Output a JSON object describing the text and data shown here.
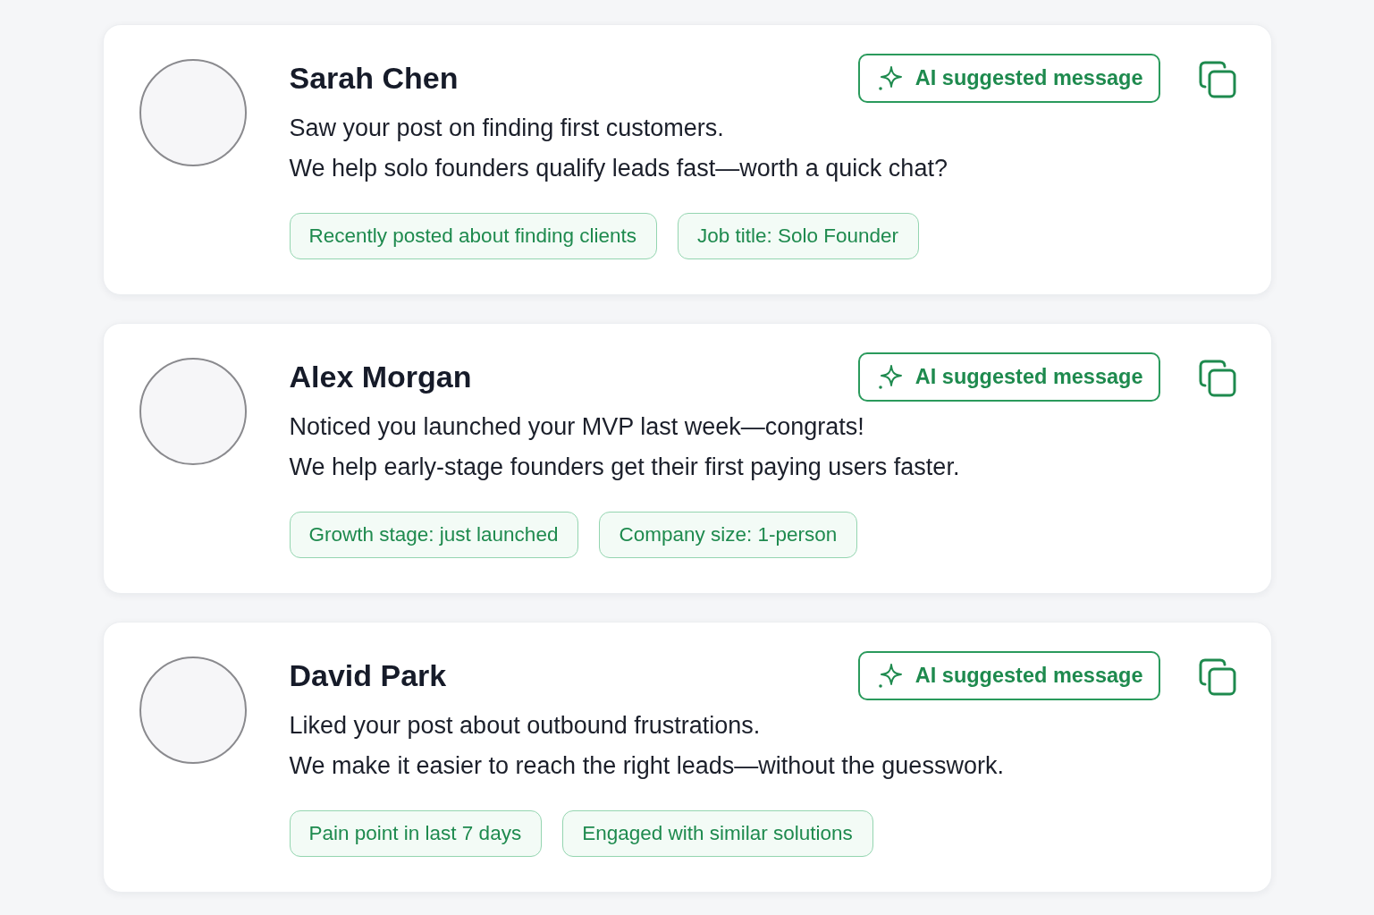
{
  "leads": [
    {
      "name": "Sarah Chen",
      "ai_button": "AI suggested message",
      "message": "Saw your post on finding first customers.\nWe help solo founders qualify leads fast—worth a quick chat?",
      "tags": [
        "Recently posted about finding clients",
        "Job title: Solo Founder"
      ]
    },
    {
      "name": "Alex Morgan",
      "ai_button": "AI suggested message",
      "message": "Noticed you launched your MVP last week—congrats!\nWe help early-stage founders get their first paying users faster.",
      "tags": [
        "Growth stage: just launched",
        "Company size: 1-person"
      ]
    },
    {
      "name": "David Park",
      "ai_button": "AI suggested message",
      "message": "Liked your post about outbound frustrations.\nWe make it easier to reach the right leads—without the guesswork.",
      "tags": [
        "Pain point in last 7 days",
        "Engaged with similar solutions"
      ]
    }
  ]
}
